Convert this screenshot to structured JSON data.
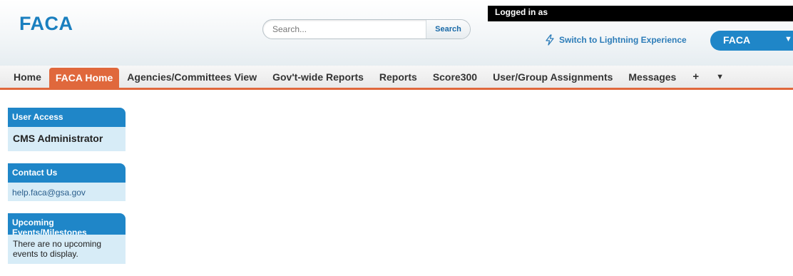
{
  "header": {
    "logo": "FACA",
    "search": {
      "placeholder": "Search...",
      "button_label": "Search"
    },
    "logged_in_text": "Logged in as",
    "lightning_link": "Switch to Lightning Experience",
    "app_switcher": {
      "label": "FACA"
    }
  },
  "tabs": [
    {
      "label": "Home",
      "active": false
    },
    {
      "label": "FACA Home",
      "active": true
    },
    {
      "label": "Agencies/Committees View",
      "active": false
    },
    {
      "label": "Gov't-wide Reports",
      "active": false
    },
    {
      "label": "Reports",
      "active": false
    },
    {
      "label": "Score300",
      "active": false
    },
    {
      "label": "User/Group Assignments",
      "active": false
    },
    {
      "label": "Messages",
      "active": false
    }
  ],
  "tab_icons": {
    "add": "+",
    "more": "▼"
  },
  "sidebar": {
    "user_access": {
      "title": "User Access",
      "value": "CMS Administrator"
    },
    "contact_us": {
      "title": "Contact Us",
      "email": "help.faca@gsa.gov"
    },
    "upcoming": {
      "title": "Upcoming Events/Milestones",
      "message": "There are no upcoming events to display."
    }
  },
  "colors": {
    "brand_blue": "#1f86c8",
    "active_tab": "#e0683c",
    "sidebar_body": "#d7ecf7"
  }
}
